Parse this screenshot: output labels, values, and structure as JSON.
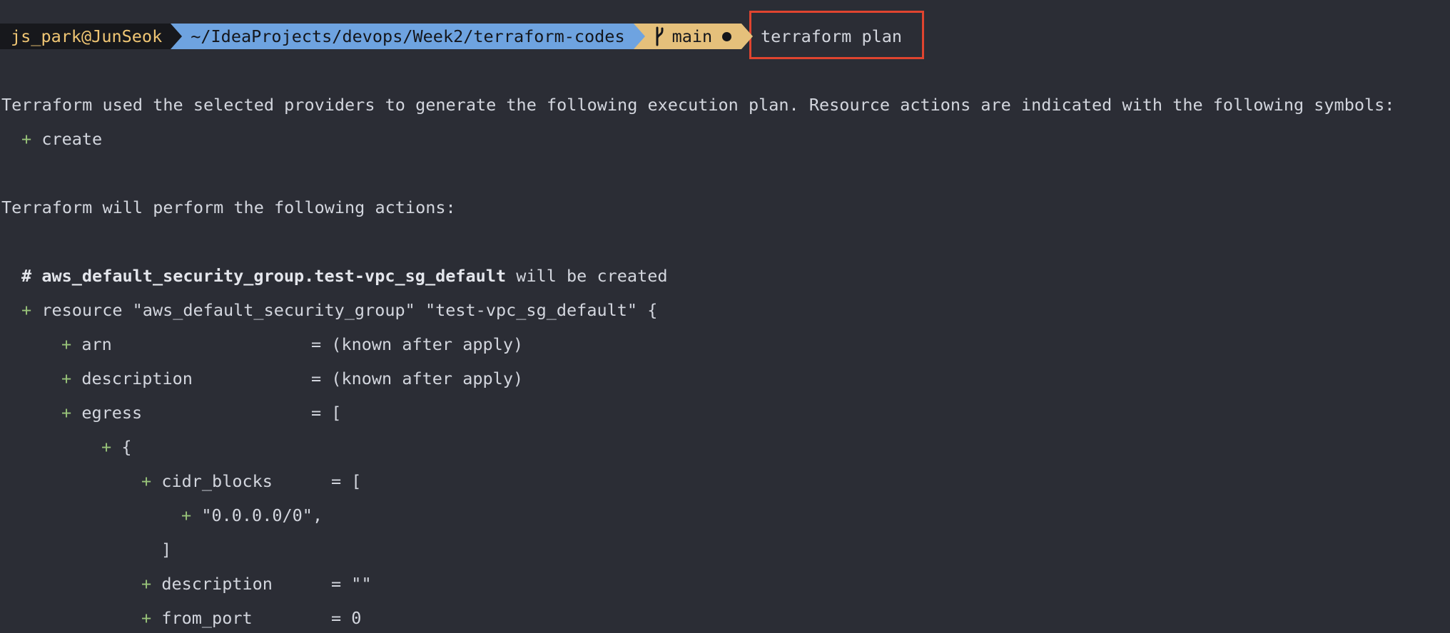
{
  "prompt": {
    "user_host": "js_park@JunSeok",
    "path": "~/IdeaProjects/devops/Week2/terraform-codes",
    "branch": "main",
    "command": "terraform plan"
  },
  "output": {
    "intro": "Terraform used the selected providers to generate the following execution plan. Resource actions are indicated with the following symbols:",
    "symbol_plus": "+",
    "symbol_create": "create",
    "actions_heading": "Terraform will perform the following actions:",
    "comment_hash": "#",
    "resource_address": "aws_default_security_group.test-vpc_sg_default",
    "will_be_created": "will be created",
    "resource_line": "resource \"aws_default_security_group\" \"test-vpc_sg_default\" {",
    "arn_key": "arn",
    "arn_value": "= (known after apply)",
    "description_key": "description",
    "description_value": "= (known after apply)",
    "egress_key": "egress",
    "egress_value": "= [",
    "open_brace": "{",
    "cidr_key": "cidr_blocks",
    "cidr_value": "= [",
    "cidr_item": "\"0.0.0.0/0\",",
    "close_bracket": "]",
    "egress_description_key": "description",
    "egress_description_value": "= \"\"",
    "from_port_key": "from_port",
    "from_port_value": "= 0"
  },
  "colors": {
    "background": "#2b2d35",
    "user_segment": "#17181c",
    "user_text": "#f0c674",
    "path_segment": "#6ea3e0",
    "git_segment": "#e5c07b",
    "plus_sign": "#98c379",
    "highlight_box": "#e0442f"
  },
  "icons": {
    "branch": "git-branch-icon",
    "dirty": "dirty-indicator-icon"
  }
}
